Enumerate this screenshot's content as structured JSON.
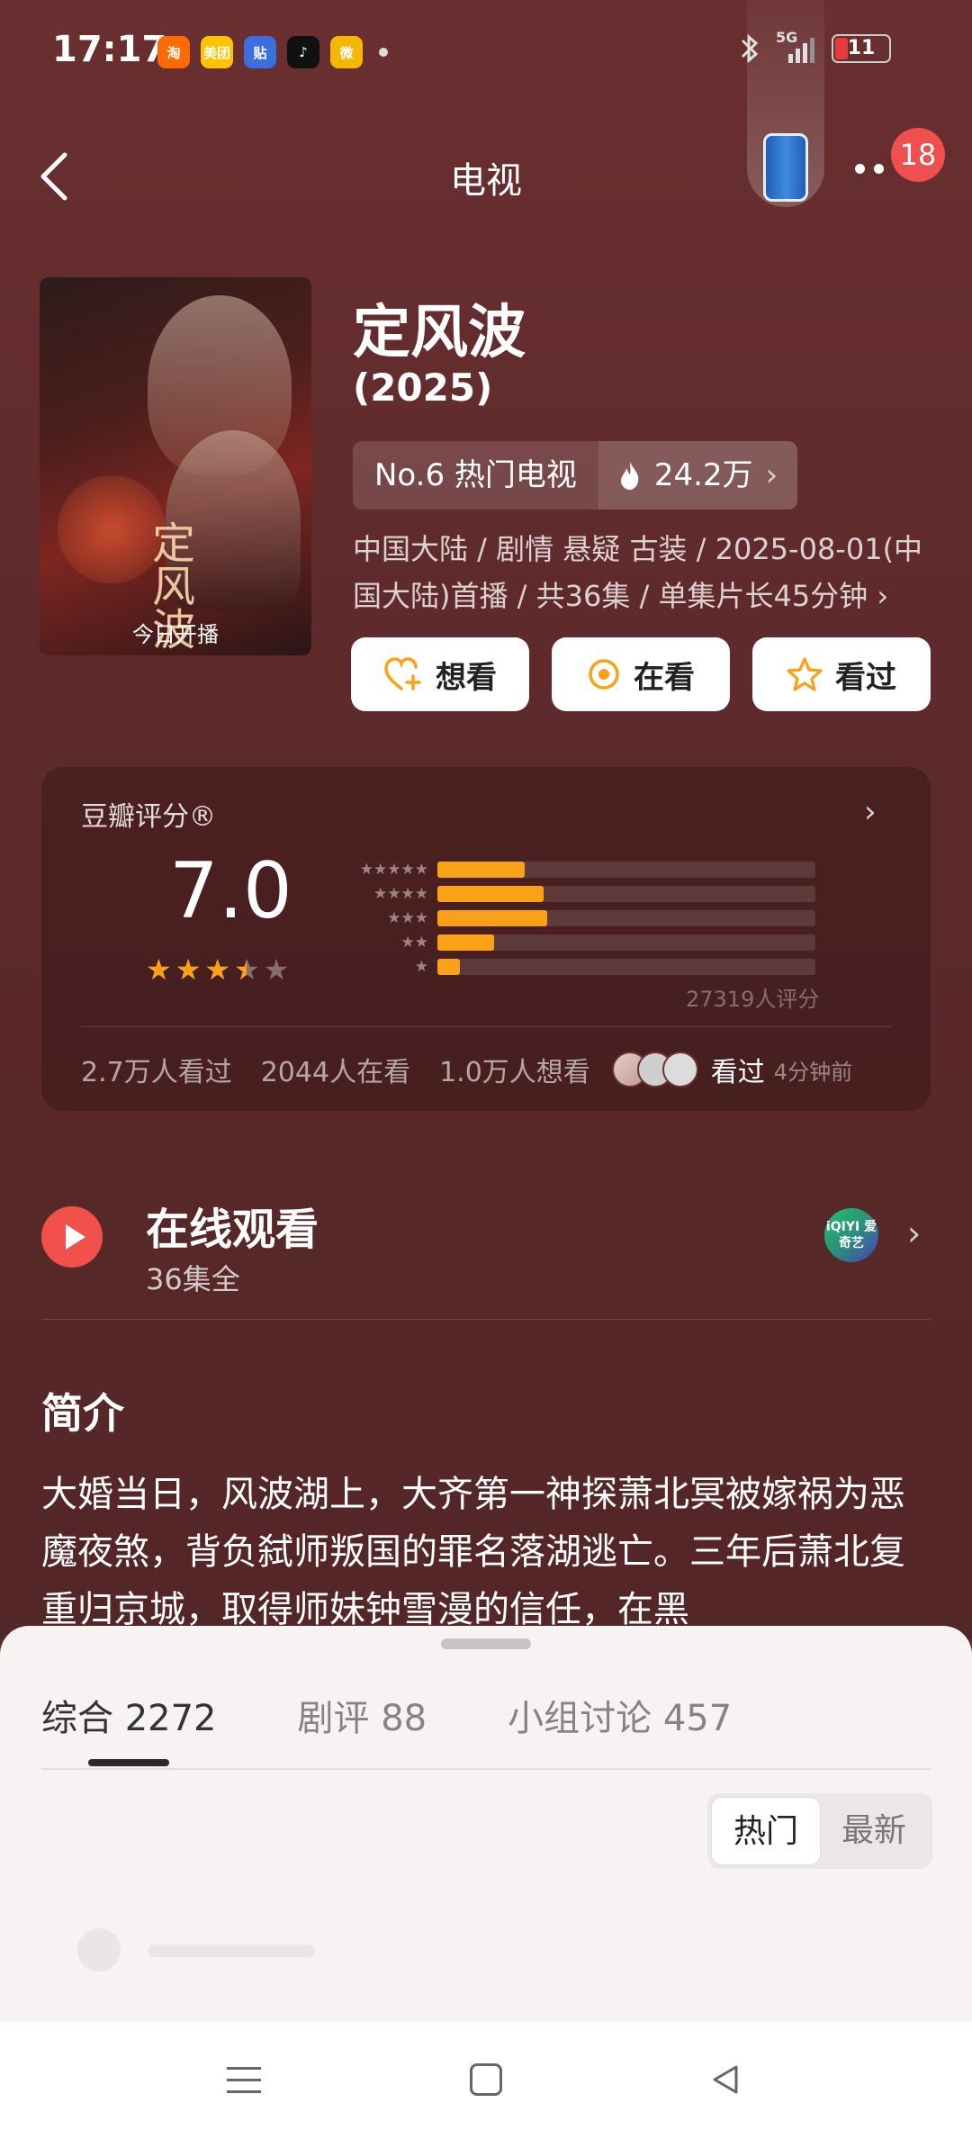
{
  "status_bar": {
    "time": "17:17",
    "apps": [
      {
        "name": "taobao-icon",
        "glyph": "淘",
        "color": "#ff6a00"
      },
      {
        "name": "meituan-icon",
        "glyph": "美团",
        "color": "#ffc300"
      },
      {
        "name": "tieba-icon",
        "glyph": "贴",
        "color": "#3b6fe0"
      },
      {
        "name": "tiktok-icon",
        "glyph": "♪",
        "color": "#111111"
      },
      {
        "name": "weibo-icon",
        "glyph": "微",
        "color": "#f5b800"
      }
    ],
    "network": "5G",
    "battery": "11"
  },
  "header": {
    "title": "电视",
    "notification_count": "18"
  },
  "show": {
    "poster_calligraphy": "定风波",
    "poster_tag": "今日开播",
    "title": "定风波",
    "year": "(2025)",
    "rank": "No.6 热门电视",
    "heat": "24.2万",
    "meta": "中国大陆 / 剧情 悬疑 古装 / 2025-08-01(中国大陆)首播 / 共36集 / 单集片长45分钟 ›"
  },
  "actions": [
    {
      "label": "想看",
      "icon": "heart-plus-icon"
    },
    {
      "label": "在看",
      "icon": "circle-dot-icon"
    },
    {
      "label": "看过",
      "icon": "star-outline-icon"
    }
  ],
  "rating": {
    "label": "豆瓣评分®",
    "score": "7.0",
    "stars_value": 3.5,
    "distribution": [
      {
        "stars": "★★★★★",
        "fraction": 0.23
      },
      {
        "stars": "★★★★",
        "fraction": 0.28
      },
      {
        "stars": "★★★",
        "fraction": 0.29
      },
      {
        "stars": "★★",
        "fraction": 0.15
      },
      {
        "stars": "★",
        "fraction": 0.06
      }
    ],
    "count": "27319人评分",
    "watched": "2.7万人看过",
    "watching": "2044人在看",
    "want": "1.0万人想看",
    "friends_seen": "看过",
    "friends_time": "4分钟前"
  },
  "online": {
    "title": "在线观看",
    "subtitle": "36集全",
    "provider": "iQIYI 爱奇艺"
  },
  "intro": {
    "title": "简介",
    "text": "大婚当日，风波湖上，大齐第一神探萧北冥被嫁祸为恶魔夜煞，背负弑师叛国的罪名落湖逃亡。三年后萧北复重归京城，取得师妹钟雪漫的信任，在黑"
  },
  "sheet": {
    "tabs": [
      {
        "label": "综合 2272"
      },
      {
        "label": "剧评 88"
      },
      {
        "label": "小组讨论 457"
      }
    ],
    "sort_hot": "热门",
    "sort_new": "最新"
  },
  "colors": {
    "accent": "#f9a217",
    "play": "#f2504b",
    "badge": "#f04f4f",
    "background": "#5f2a2b"
  }
}
